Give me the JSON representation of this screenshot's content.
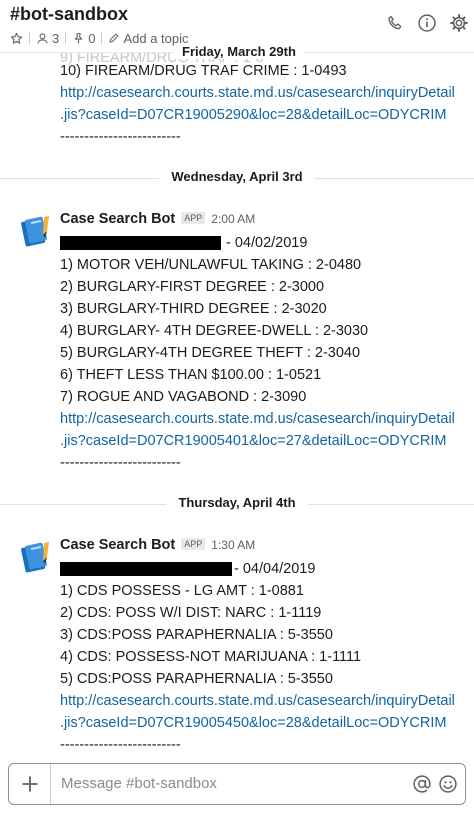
{
  "header": {
    "channel": "#bot-sandbox",
    "members": "3",
    "pins": "0",
    "add_topic": "Add a topic"
  },
  "sticky_date": "Friday, March 29th",
  "prev_message": {
    "item10": "10) FIREARM/DRUG TRAF CRIME : 1-0493",
    "link_line1": "http://casesearch.courts.state.md.us/casesearch/inquiryDetail",
    "link_line2": ".jis?caseId=D07CR19005290&loc=28&detailLoc=ODYCRIM",
    "dashes": "-------------------------"
  },
  "dividers": {
    "d1": "Wednesday, April 3rd",
    "d2": "Thursday, April 4th"
  },
  "messages": [
    {
      "sender": "Case Search Bot",
      "badge": "APP",
      "time": "2:00 AM",
      "date_suffix": "- 04/02/2019",
      "items": [
        "1) MOTOR VEH/UNLAWFUL TAKING : 2-0480",
        "2) BURGLARY-FIRST DEGREE : 2-3000",
        "3) BURGLARY-THIRD DEGREE : 2-3020",
        "4) BURGLARY- 4TH DEGREE-DWELL : 2-3030",
        "5) BURGLARY-4TH DEGREE THEFT : 2-3040",
        "6) THEFT LESS THAN $100.00 : 1-0521",
        "7) ROGUE AND VAGABOND : 2-3090"
      ],
      "link_line1": "http://casesearch.courts.state.md.us/casesearch/inquiryDetail",
      "link_line2": ".jis?caseId=D07CR19005401&loc=27&detailLoc=ODYCRIM",
      "dashes": "-------------------------"
    },
    {
      "sender": "Case Search Bot",
      "badge": "APP",
      "time": "1:30 AM",
      "date_suffix": "- 04/04/2019",
      "items": [
        "1) CDS POSSESS - LG AMT : 1-0881",
        "2) CDS: POSS W/I DIST: NARC : 1-1119",
        "3) CDS:POSS PARAPHERNALIA : 5-3550",
        "4) CDS: POSSESS-NOT MARIJUANA : 1-1111",
        "5) CDS:POSS PARAPHERNALIA : 5-3550"
      ],
      "link_line1": "http://casesearch.courts.state.md.us/casesearch/inquiryDetail",
      "link_line2": ".jis?caseId=D07CR19005450&loc=28&detailLoc=ODYCRIM",
      "dashes": "-------------------------"
    }
  ],
  "composer": {
    "placeholder": "Message #bot-sandbox"
  },
  "icons": {
    "star": "star-icon",
    "members": "person-icon",
    "pin": "pin-icon",
    "edit": "pencil-icon",
    "call": "phone-icon",
    "info": "info-icon",
    "settings": "gear-icon",
    "add": "plus-icon",
    "mention": "at-icon",
    "emoji": "emoji-icon"
  }
}
